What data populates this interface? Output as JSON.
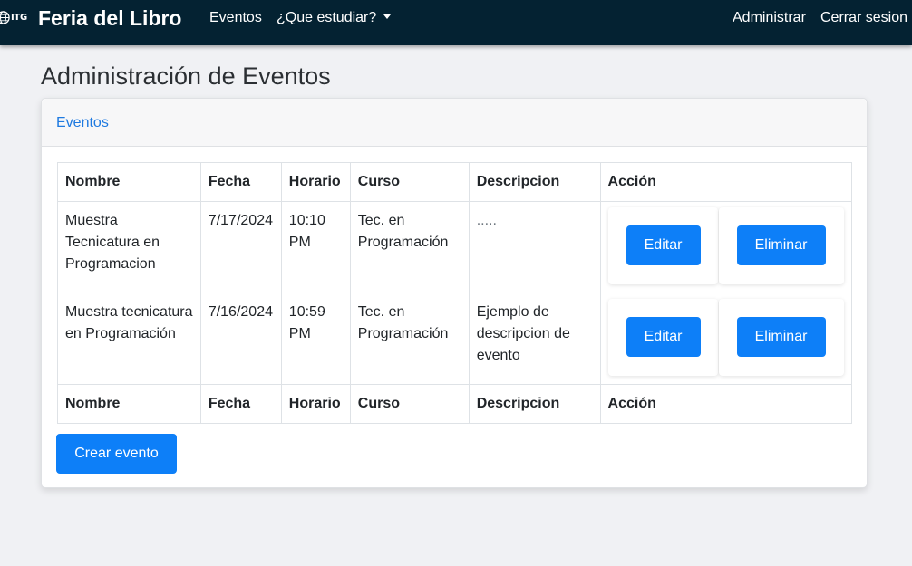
{
  "navbar": {
    "logo_text": "ITG",
    "brand": "Feria del Libro",
    "links": {
      "eventos": "Eventos",
      "que_estudiar": "¿Que estudiar?"
    },
    "right": {
      "administrar": "Administrar",
      "cerrar_sesion": "Cerrar sesion"
    },
    "colors": {
      "background": "#042232",
      "text": "#ffffff"
    }
  },
  "page": {
    "title": "Administración de Eventos"
  },
  "card": {
    "header": "Eventos",
    "table": {
      "columns": [
        "Nombre",
        "Fecha",
        "Horario",
        "Curso",
        "Descripcion",
        "Acción"
      ],
      "rows": [
        {
          "nombre": "Muestra Tecnicatura en Programacion",
          "fecha": "7/17/2024",
          "horario": "10:10 PM",
          "curso": "Tec. en Programación",
          "descripcion": ".....",
          "edit_label": "Editar",
          "delete_label": "Eliminar"
        },
        {
          "nombre": "Muestra tecnicatura en Programación",
          "fecha": "7/16/2024",
          "horario": "10:59 PM",
          "curso": "Tec. en Programación",
          "descripcion": "Ejemplo de descripcion de evento",
          "edit_label": "Editar",
          "delete_label": "Eliminar"
        }
      ]
    },
    "create_button": "Crear evento"
  },
  "colors": {
    "accent": "#0d7ff8",
    "link": "#1f7ae0",
    "page_background": "#f0f1f4"
  }
}
